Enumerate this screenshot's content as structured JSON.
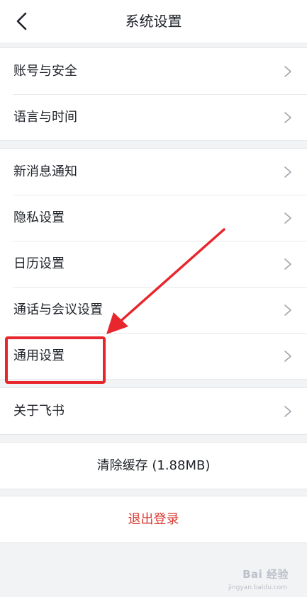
{
  "header": {
    "title": "系统设置",
    "back_icon": "chevron-left-icon"
  },
  "group1": {
    "items": [
      {
        "label": "账号与安全"
      },
      {
        "label": "语言与时间"
      }
    ]
  },
  "group2": {
    "items": [
      {
        "label": "新消息通知"
      },
      {
        "label": "隐私设置"
      },
      {
        "label": "日历设置"
      },
      {
        "label": "通话与会议设置"
      },
      {
        "label": "通用设置"
      }
    ]
  },
  "group3": {
    "items": [
      {
        "label": "关于飞书"
      }
    ]
  },
  "actions": {
    "clear_cache_label": "清除缓存 (1.88MB)",
    "logout_label": "退出登录"
  },
  "annotation": {
    "highlight_color": "#e8262d",
    "arrow_color": "#e8262d"
  },
  "watermark": {
    "text": "Bai 经验",
    "sub_text": "jingyan.baidu.com"
  },
  "colors": {
    "background": "#f2f3f5",
    "text": "#1f2329",
    "logout": "#d83931",
    "chevron": "#a0a4ab"
  }
}
